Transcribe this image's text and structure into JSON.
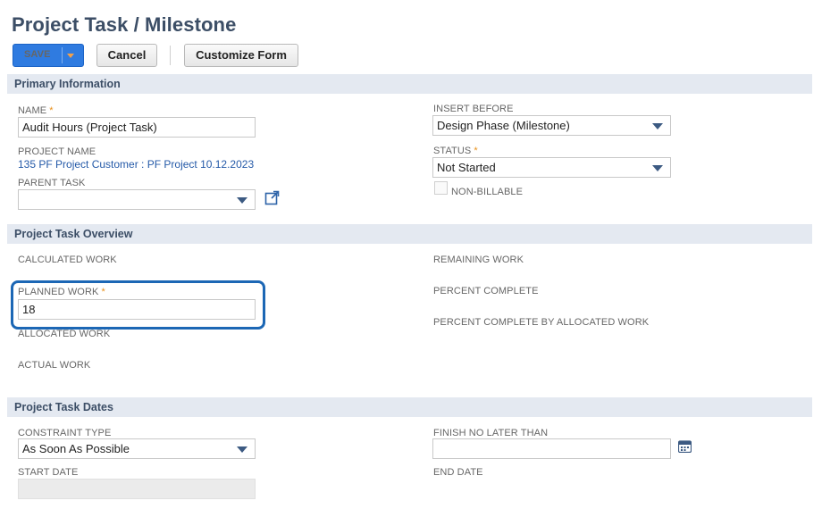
{
  "page": {
    "title": "Project Task / Milestone"
  },
  "toolbar": {
    "save": "Save",
    "cancel": "Cancel",
    "customize": "Customize Form"
  },
  "sections": {
    "primary": "Primary Information",
    "overview": "Project Task Overview",
    "dates": "Project Task Dates"
  },
  "primary": {
    "name_label": "NAME",
    "name_value": "Audit Hours (Project Task)",
    "project_label": "PROJECT NAME",
    "project_value": "135 PF Project Customer : PF Project 10.12.2023",
    "parent_label": "PARENT TASK",
    "parent_value": "",
    "insert_label": "INSERT BEFORE",
    "insert_value": "Design Phase (Milestone)",
    "status_label": "STATUS",
    "status_value": "Not Started",
    "nonbillable_label": "NON-BILLABLE",
    "required_mark": "*"
  },
  "overview": {
    "calculated_label": "CALCULATED WORK",
    "planned_label": "PLANNED WORK",
    "planned_value": "18",
    "allocated_label": "ALLOCATED WORK",
    "actual_label": "ACTUAL WORK",
    "remaining_label": "REMAINING WORK",
    "percent_label": "PERCENT COMPLETE",
    "percent_alloc_label": "PERCENT COMPLETE BY ALLOCATED WORK"
  },
  "dates": {
    "constraint_label": "CONSTRAINT TYPE",
    "constraint_value": "As Soon As Possible",
    "start_label": "START DATE",
    "finish_label": "FINISH NO LATER THAN",
    "end_label": "END DATE"
  },
  "colors": {
    "accent": "#2f7be0",
    "highlight": "#1c67b5",
    "required": "#e8911c"
  },
  "icons": {
    "open_record": "external-link-icon",
    "calendar": "calendar-icon"
  }
}
